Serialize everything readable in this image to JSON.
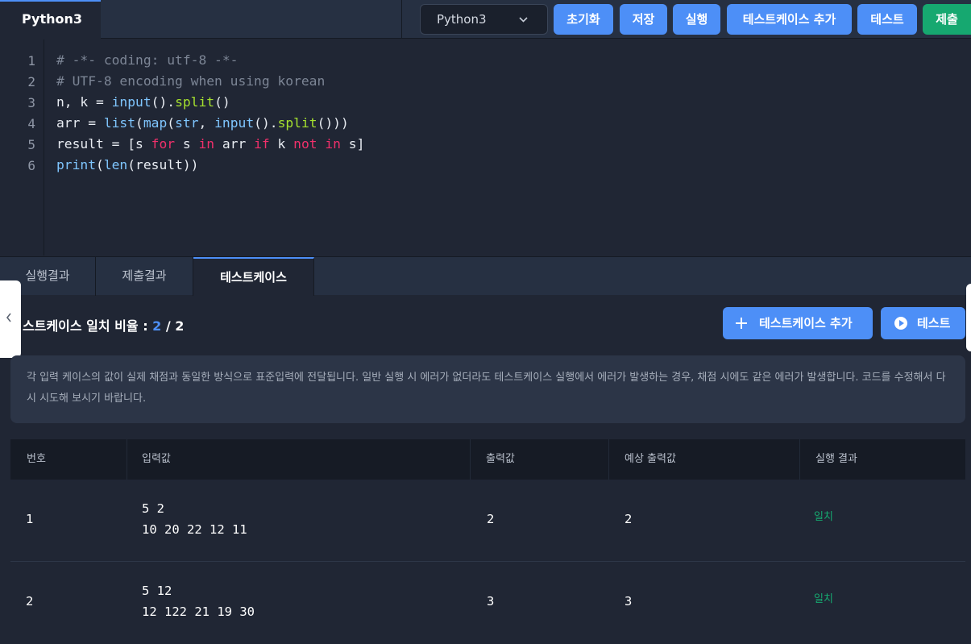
{
  "topbar": {
    "file_tab": "Python3",
    "language": "Python3",
    "buttons": {
      "reset": "초기화",
      "save": "저장",
      "run": "실행",
      "add_testcase": "테스트케이스 추가",
      "test": "테스트",
      "submit": "제출"
    }
  },
  "editor": {
    "line_numbers": [
      "1",
      "2",
      "3",
      "4",
      "5",
      "6"
    ],
    "lines": [
      "# -*- coding: utf-8 -*-",
      "# UTF-8 encoding when using korean",
      "n, k = input().split()",
      "arr = list(map(str, input().split()))",
      "result = [s for s in arr if k not in s]",
      "print(len(result))"
    ]
  },
  "bottom_tabs": [
    "실행결과",
    "제출결과",
    "테스트케이스"
  ],
  "testcase_panel": {
    "ratio_label": "스트케이스 일치 비율  :",
    "ratio_matched": "2",
    "ratio_total": "/ 2",
    "add_button": "테스트케이스 추가",
    "test_button": "테스트",
    "notice": "각 입력 케이스의 값이 실제 채점과 동일한 방식으로 표준입력에 전달됩니다. 일반 실행 시 에러가 없더라도 테스트케이스 실행에서 에러가 발생하는 경우, 채점 시에도 같은 에러가 발생합니다. 코드를 수정해서 다시 시도해 보시기 바랍니다."
  },
  "table": {
    "headers": [
      "번호",
      "입력값",
      "출력값",
      "예상 출력값",
      "실행 결과"
    ],
    "rows": [
      {
        "no": "1",
        "input_line1": "5 2",
        "input_line2": "10 20 22 12 11",
        "output": "2",
        "expected": "2",
        "result": "일치"
      },
      {
        "no": "2",
        "input_line1": "5 12",
        "input_line2": "12 122 21 19 30",
        "output": "3",
        "expected": "3",
        "result": "일치"
      }
    ]
  },
  "colors": {
    "accent": "#4d8ff7",
    "success": "#16a870",
    "background": "#202634",
    "keyword": "#f1306b",
    "method": "#a6e22e",
    "builtin": "#7fc6ff"
  }
}
